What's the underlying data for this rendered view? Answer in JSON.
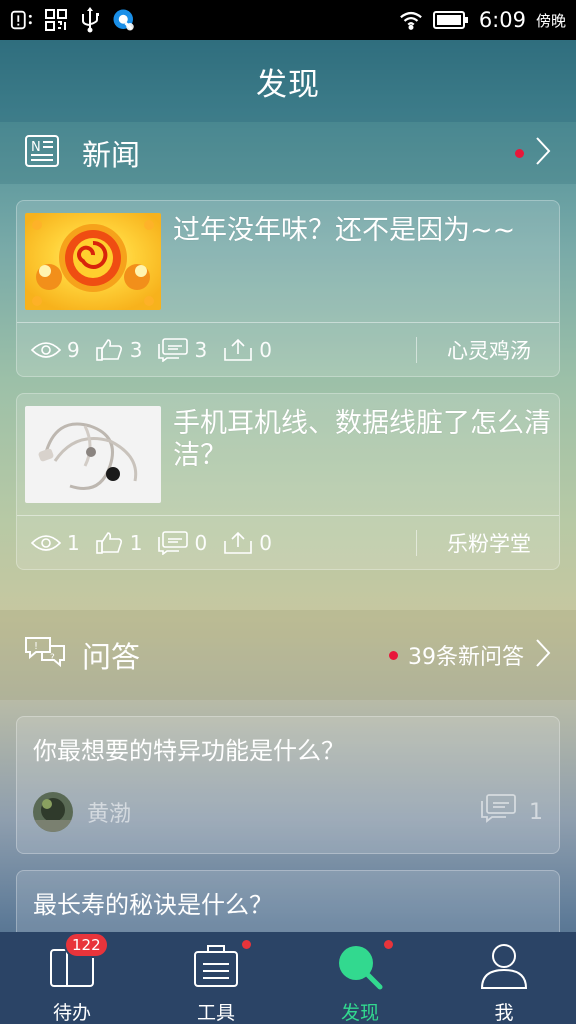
{
  "status_bar": {
    "time": "6:09",
    "carrier_text": "傍晚"
  },
  "header": {
    "title": "发现"
  },
  "news_section": {
    "label": "新闻",
    "has_new": true
  },
  "news": [
    {
      "title": "过年没年味？还不是因为~~",
      "views": "9",
      "likes": "3",
      "comments": "3",
      "shares": "0",
      "source": "心灵鸡汤"
    },
    {
      "title": "手机耳机线、数据线脏了怎么清洁？",
      "views": "1",
      "likes": "1",
      "comments": "0",
      "shares": "0",
      "source": "乐粉学堂"
    }
  ],
  "qa_section": {
    "label": "问答",
    "new_text": "39条新问答"
  },
  "qa": [
    {
      "question": "你最想要的特异功能是什么？",
      "user": "黄渤",
      "answers": "1"
    },
    {
      "question": "最长寿的秘诀是什么？"
    }
  ],
  "bottom_nav": {
    "items": [
      {
        "label": "待办",
        "badge": "122"
      },
      {
        "label": "工具"
      },
      {
        "label": "发现"
      },
      {
        "label": "我"
      }
    ]
  },
  "colors": {
    "accent_active": "#32d98f",
    "badge_red": "#e8343b",
    "nav_bg": "#2b4466"
  }
}
